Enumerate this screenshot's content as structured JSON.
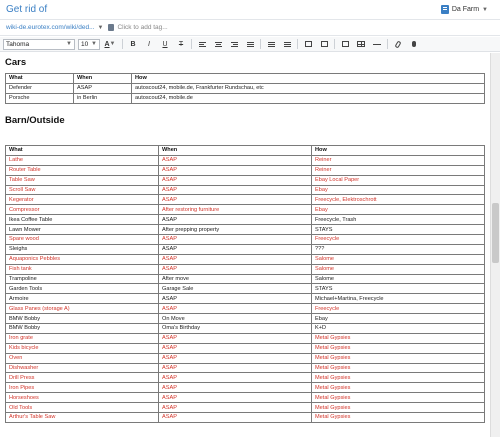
{
  "header": {
    "note_title": "Get rid of",
    "notebook": "Da Farm",
    "url": "wiki-de.eurotex.com/wiki/ded...",
    "tag_hint": "Click to add tag..."
  },
  "toolbar": {
    "font_face": "Tahoma",
    "font_size": "10",
    "bold": "B",
    "italic": "I",
    "underline": "U",
    "strike": "T",
    "text_color": "A"
  },
  "colors": {
    "accent": "#3a7fc4",
    "red_text": "#d2352b"
  },
  "cars": {
    "heading": "Cars",
    "headers": [
      "What",
      "When",
      "How"
    ],
    "rows": [
      [
        "Defender",
        "ASAP",
        "autoscout24, mobile.de, Frankfurter Rundschau, etc"
      ],
      [
        "Porsche",
        "in Berlin",
        "autoscout24, mobile.de"
      ]
    ]
  },
  "barn": {
    "heading": "Barn/Outside",
    "headers": [
      "What",
      "When",
      "How"
    ],
    "rows": [
      {
        "cells": [
          "Lathe",
          "ASAP",
          "Reiner"
        ],
        "red": true
      },
      {
        "cells": [
          "Router Table",
          "ASAP",
          "Reiner"
        ],
        "red": true
      },
      {
        "cells": [
          "Table Saw",
          "ASAP",
          "Ebay Local Paper"
        ],
        "red": true
      },
      {
        "cells": [
          "Scroll Saw",
          "ASAP",
          "Ebay"
        ],
        "red": true
      },
      {
        "cells": [
          "Kegerator",
          "ASAP",
          "Freecycle, Elektroschrott"
        ],
        "red": true
      },
      {
        "cells": [
          "Compressor",
          "After restoring furniture",
          "Ebay"
        ],
        "red": true
      },
      {
        "cells": [
          "Ikea Coffee Table",
          "ASAP",
          "Freecycle, Trash"
        ],
        "red": false
      },
      {
        "cells": [
          "Lawn Mower",
          "After prepping property",
          "STAYS"
        ],
        "red": false
      },
      {
        "cells": [
          "Spare wood",
          "ASAP",
          "Freecycle"
        ],
        "red": true
      },
      {
        "cells": [
          "Sleighs",
          "ASAP",
          "???"
        ],
        "red": false
      },
      {
        "cells": [
          "Aquaponics Pebbles",
          "ASAP",
          "Salome"
        ],
        "red": true
      },
      {
        "cells": [
          "Fish tank",
          "ASAP",
          "Salome"
        ],
        "red": true
      },
      {
        "cells": [
          "Trampoline",
          "After move",
          "Salome"
        ],
        "red": false
      },
      {
        "cells": [
          "Garden Tools",
          "Garage Sale",
          "STAYS"
        ],
        "red": false
      },
      {
        "cells": [
          "Armoire",
          "ASAP",
          "Michael+Martina, Freecycle"
        ],
        "red": false
      },
      {
        "cells": [
          "Glass Panes (storage A)",
          "ASAP",
          "Freecycle"
        ],
        "red": true
      },
      {
        "cells": [
          "BMW Bobby",
          "On Move",
          "Ebay"
        ],
        "red": false
      },
      {
        "cells": [
          "BMW Bobby",
          "Oma's Birthday",
          "K+D"
        ],
        "red": false
      },
      {
        "cells": [
          "Iron grate",
          "ASAP",
          "Metal Gypsies"
        ],
        "red": true
      },
      {
        "cells": [
          "Kids bicycle",
          "ASAP",
          "Metal Gypsies"
        ],
        "red": true
      },
      {
        "cells": [
          "Oven",
          "ASAP",
          "Metal Gypsies"
        ],
        "red": true
      },
      {
        "cells": [
          "Dishwasher",
          "ASAP",
          "Metal Gypsies"
        ],
        "red": true
      },
      {
        "cells": [
          "Drill Press",
          "ASAP",
          "Metal Gypsies"
        ],
        "red": true
      },
      {
        "cells": [
          "Iron Pipes",
          "ASAP",
          "Metal Gypsies"
        ],
        "red": true
      },
      {
        "cells": [
          "Horseshoes",
          "ASAP",
          "Metal Gypsies"
        ],
        "red": true
      },
      {
        "cells": [
          "Old Tools",
          "ASAP",
          "Metal Gypsies"
        ],
        "red": true
      },
      {
        "cells": [
          "Arthur's Table Saw",
          "ASAP",
          "Metal Gypsies"
        ],
        "red": true
      }
    ]
  }
}
